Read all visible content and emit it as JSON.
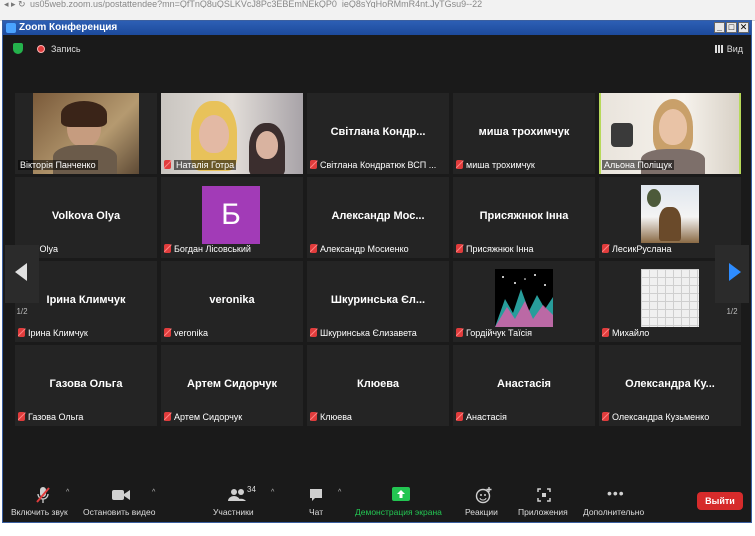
{
  "browser": {
    "url": "us05web.zoom.us/postattendee?mn=QfTnQ8uQSLKVcJ8Pc3EBEmNEkQP0_ieQ8sYqHoRMmR4nt.JyTGsu9--22"
  },
  "window": {
    "title": "Zoom Конференция",
    "minimize": "_",
    "maximize": "□",
    "close": "✕"
  },
  "topbar": {
    "record_label": "Запись",
    "view_label": "Вид"
  },
  "participants": [
    {
      "name": "Вікторія Панченко",
      "big": "",
      "kind": "video",
      "muted": false
    },
    {
      "name": "Наталія Готра",
      "big": "",
      "kind": "video",
      "muted": true
    },
    {
      "name": "Світлана Кондратюк ВСП ...",
      "big": "Світлана Кондр...",
      "kind": "name",
      "muted": true
    },
    {
      "name": "миша трохимчук",
      "big": "миша трохимчук",
      "kind": "name",
      "muted": true
    },
    {
      "name": "Альона Поліщук",
      "big": "",
      "kind": "video",
      "muted": false,
      "active": true
    },
    {
      "name": "kova Olya",
      "big": "Volkova Olya",
      "kind": "name",
      "muted": false
    },
    {
      "name": "Богдан Лісовський",
      "big": "",
      "kind": "avatar",
      "avatar_letter": "Б",
      "muted": true
    },
    {
      "name": "Александр Мосиенко",
      "big": "Александр Мос...",
      "kind": "name",
      "muted": true
    },
    {
      "name": "Присяжнюк Інна",
      "big": "Присяжнюк Інна",
      "kind": "name",
      "muted": true
    },
    {
      "name": "ЛесикРуслана",
      "big": "",
      "kind": "photo",
      "muted": true
    },
    {
      "name": "Ірина Климчук",
      "big": "Ірина Климчук",
      "kind": "name",
      "muted": true
    },
    {
      "name": "veronika",
      "big": "veronika",
      "kind": "name",
      "muted": true
    },
    {
      "name": "Шкуринська Єлизавета",
      "big": "Шкуринська Єл...",
      "kind": "name",
      "muted": true
    },
    {
      "name": "Гордійчук Таїсія",
      "big": "",
      "kind": "image",
      "muted": true
    },
    {
      "name": "Михайло",
      "big": "",
      "kind": "grid",
      "muted": true
    },
    {
      "name": "Газова Ольга",
      "big": "Газова Ольга",
      "kind": "name",
      "muted": true
    },
    {
      "name": "Артем Сидорчук",
      "big": "Артем Сидорчук",
      "kind": "name",
      "muted": true
    },
    {
      "name": "Клюева",
      "big": "Клюева",
      "kind": "name",
      "muted": true
    },
    {
      "name": "Анастасія",
      "big": "Анастасія",
      "kind": "name",
      "muted": true
    },
    {
      "name": "Олександра Кузьменко",
      "big": "Олександра Ку...",
      "kind": "name",
      "muted": true
    }
  ],
  "pagination": {
    "left_page": "1/2",
    "right_page": "1/2"
  },
  "toolbar": {
    "unmute": "Включить звук",
    "stop_video": "Остановить видео",
    "participants": "Участники",
    "participants_count": "34",
    "chat": "Чат",
    "share_screen": "Демонстрация экрана",
    "reactions": "Реакции",
    "apps": "Приложения",
    "more": "Дополнительно",
    "leave": "Выйти"
  },
  "colors": {
    "share_green": "#23c552",
    "leave_red": "#d62b2b",
    "active_speaker": "#b7d95a"
  }
}
